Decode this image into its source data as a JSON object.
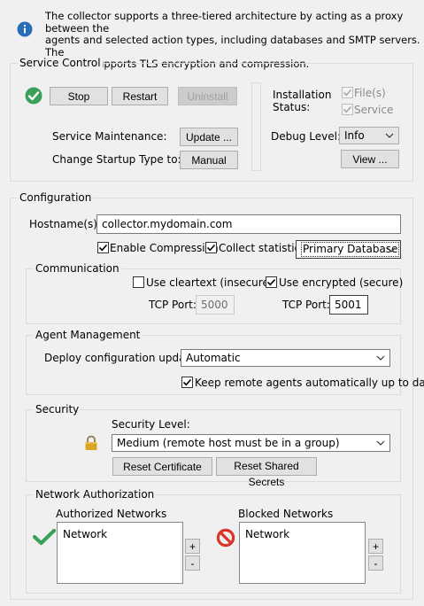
{
  "info": {
    "icon": "info-icon",
    "lines": [
      "The collector supports a three-tiered architecture by acting as a proxy between the",
      "agents and selected action types, including databases and SMTP servers. The",
      "collector supports TLS encryption and compression."
    ]
  },
  "service_control": {
    "title": "Service Control",
    "status_icon": "check-circle-icon",
    "stop_label": "Stop",
    "restart_label": "Restart",
    "uninstall_label": "Uninstall",
    "maintenance_label": "Service Maintenance:",
    "update_label": "Update ...",
    "startup_label": "Change Startup Type to:",
    "manual_label": "Manual",
    "installation_status_label": "Installation\nStatus:",
    "installation_status_line1": "Installation",
    "installation_status_line2": "Status:",
    "files_label": "File(s)",
    "files_checked": true,
    "service_label": "Service",
    "service_checked": true,
    "debug_level_label": "Debug Level:",
    "debug_level_value": "Info",
    "view_label": "View ..."
  },
  "configuration": {
    "title": "Configuration",
    "hostname_label": "Hostname(s):",
    "hostname_value": "collector.mydomain.com",
    "enable_compression_label": "Enable Compression",
    "enable_compression_checked": true,
    "collect_statistics_label": "Collect statistics:",
    "collect_statistics_checked": true,
    "statistics_target": "Primary Database",
    "communication": {
      "title": "Communication",
      "cleartext_label": "Use cleartext (insecure)",
      "cleartext_checked": false,
      "encrypted_label": "Use encrypted (secure)",
      "encrypted_checked": true,
      "tcp_port_label": "TCP Port:",
      "cleartext_port": "5000",
      "encrypted_port": "5001"
    },
    "agent_management": {
      "title": "Agent Management",
      "deploy_label": "Deploy configuration updates:",
      "deploy_value": "Automatic",
      "keep_uptodate_label": "Keep remote agents automatically up to date",
      "keep_uptodate_checked": true
    },
    "security": {
      "title": "Security",
      "icon": "lock-icon",
      "level_label": "Security Level:",
      "level_value": "Medium (remote host must be in a group)",
      "reset_certificate_label": "Reset Certificate",
      "reset_secrets_label": "Reset Shared Secrets"
    },
    "network_authorization": {
      "title": "Network Authorization",
      "authorized_label": "Authorized Networks",
      "authorized_column": "Network",
      "blocked_label": "Blocked Networks",
      "blocked_column": "Network",
      "add_label": "+",
      "remove_label": "-"
    }
  },
  "colors": {
    "info_blue": "#2a6ebb",
    "check_green": "#3aa15a",
    "block_red": "#d9352b",
    "lock_gold": "#d9a520"
  }
}
